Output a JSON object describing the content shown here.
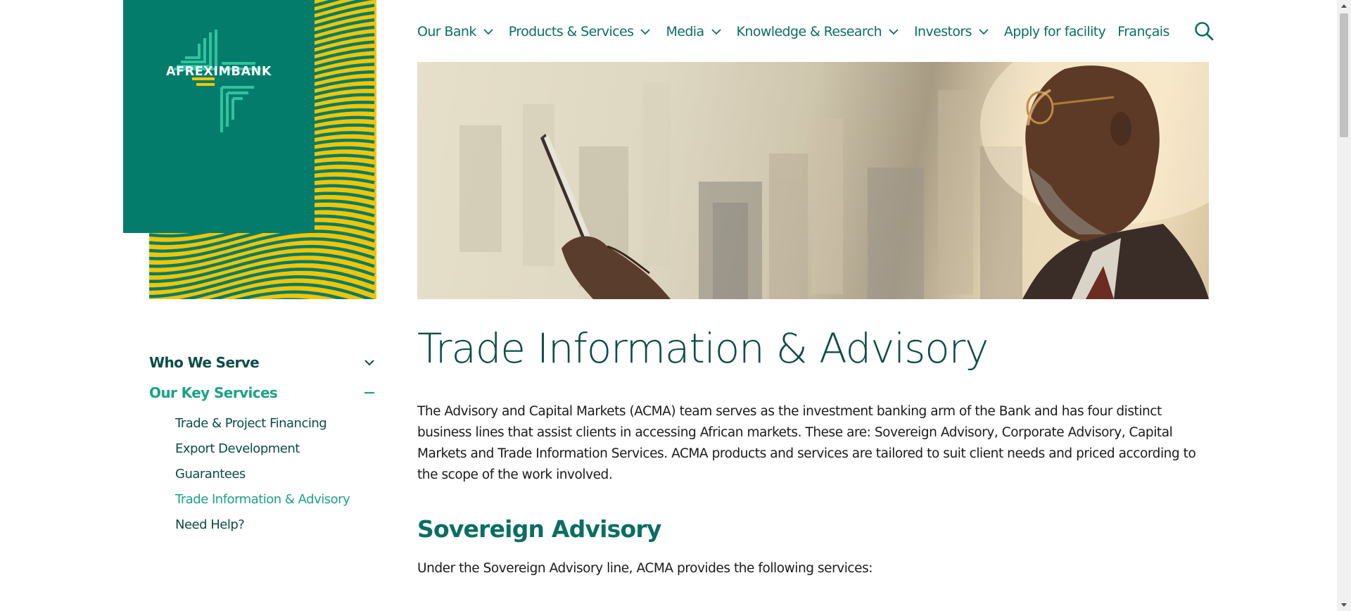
{
  "brand": {
    "name": "AFREXIMBANK",
    "colors": {
      "teal": "#047c6b",
      "yellow": "#f2c500",
      "dark_green": "#0b4d45",
      "accent_green": "#1aa287"
    }
  },
  "nav": {
    "items": [
      {
        "label": "Our Bank",
        "has_dropdown": true
      },
      {
        "label": "Products & Services",
        "has_dropdown": true
      },
      {
        "label": "Media",
        "has_dropdown": true
      },
      {
        "label": "Knowledge & Research",
        "has_dropdown": true
      },
      {
        "label": "Investors",
        "has_dropdown": true
      },
      {
        "label": "Apply for facility",
        "has_dropdown": false
      },
      {
        "label": "Français",
        "has_dropdown": false
      }
    ],
    "search_icon": "search-icon"
  },
  "hero": {
    "image": "businessman-with-tablet-city-skyline"
  },
  "sidebar": {
    "sections": [
      {
        "label": "Who We Serve",
        "state": "collapsed",
        "icon": "chevron-down-icon"
      },
      {
        "label": "Our Key Services",
        "state": "expanded",
        "icon": "minus-icon"
      }
    ],
    "sub_items": [
      {
        "label": "Trade & Project Financing",
        "current": false
      },
      {
        "label": "Export Development",
        "current": false
      },
      {
        "label": "Guarantees",
        "current": false
      },
      {
        "label": "Trade Information & Advisory",
        "current": true
      },
      {
        "label": "Need Help?",
        "current": false
      }
    ]
  },
  "main": {
    "title": "Trade Information & Advisory",
    "intro": "The Advisory and Capital Markets (ACMA) team serves as the investment banking arm of the Bank and has four distinct business lines that assist clients in accessing African markets. These are: Sovereign Advisory, Corporate Advisory, Capital Markets and Trade Information Services. ACMA products and services are tailored to suit client needs and priced according to the scope of the work involved.",
    "section_heading": "Sovereign Advisory",
    "section_text": "Under the Sovereign Advisory line, ACMA provides the following services:"
  }
}
